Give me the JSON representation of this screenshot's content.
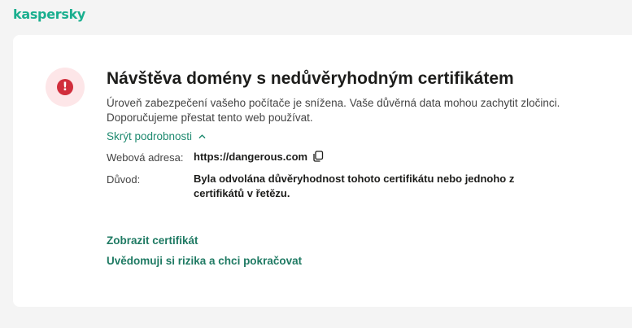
{
  "brand": {
    "logo_text": "kaspersky"
  },
  "alert": {
    "title": "Návštěva domény s nedůvěryhodným certifikátem",
    "description": "Úroveň zabezpečení vašeho počítače je snížena. Vaše důvěrná data mohou zachytit zločinci. Doporučujeme přestat tento web používat.",
    "toggle_label": "Skrýt podrobnosti",
    "icon_glyph": "!",
    "colors": {
      "danger": "#d12e3c",
      "accent": "#1aaf8f",
      "link": "#1f7a63"
    }
  },
  "details": {
    "address_label": "Webová adresa:",
    "address_value": "https://dangerous.com",
    "reason_label": "Důvod:",
    "reason_value": "Byla odvolána důvěryhodnost tohoto certifikátu nebo jednoho z certifikátů v řetězu."
  },
  "actions": {
    "view_certificate": "Zobrazit certifikát",
    "accept_risk": "Uvědomuji si rizika a chci pokračovat"
  }
}
